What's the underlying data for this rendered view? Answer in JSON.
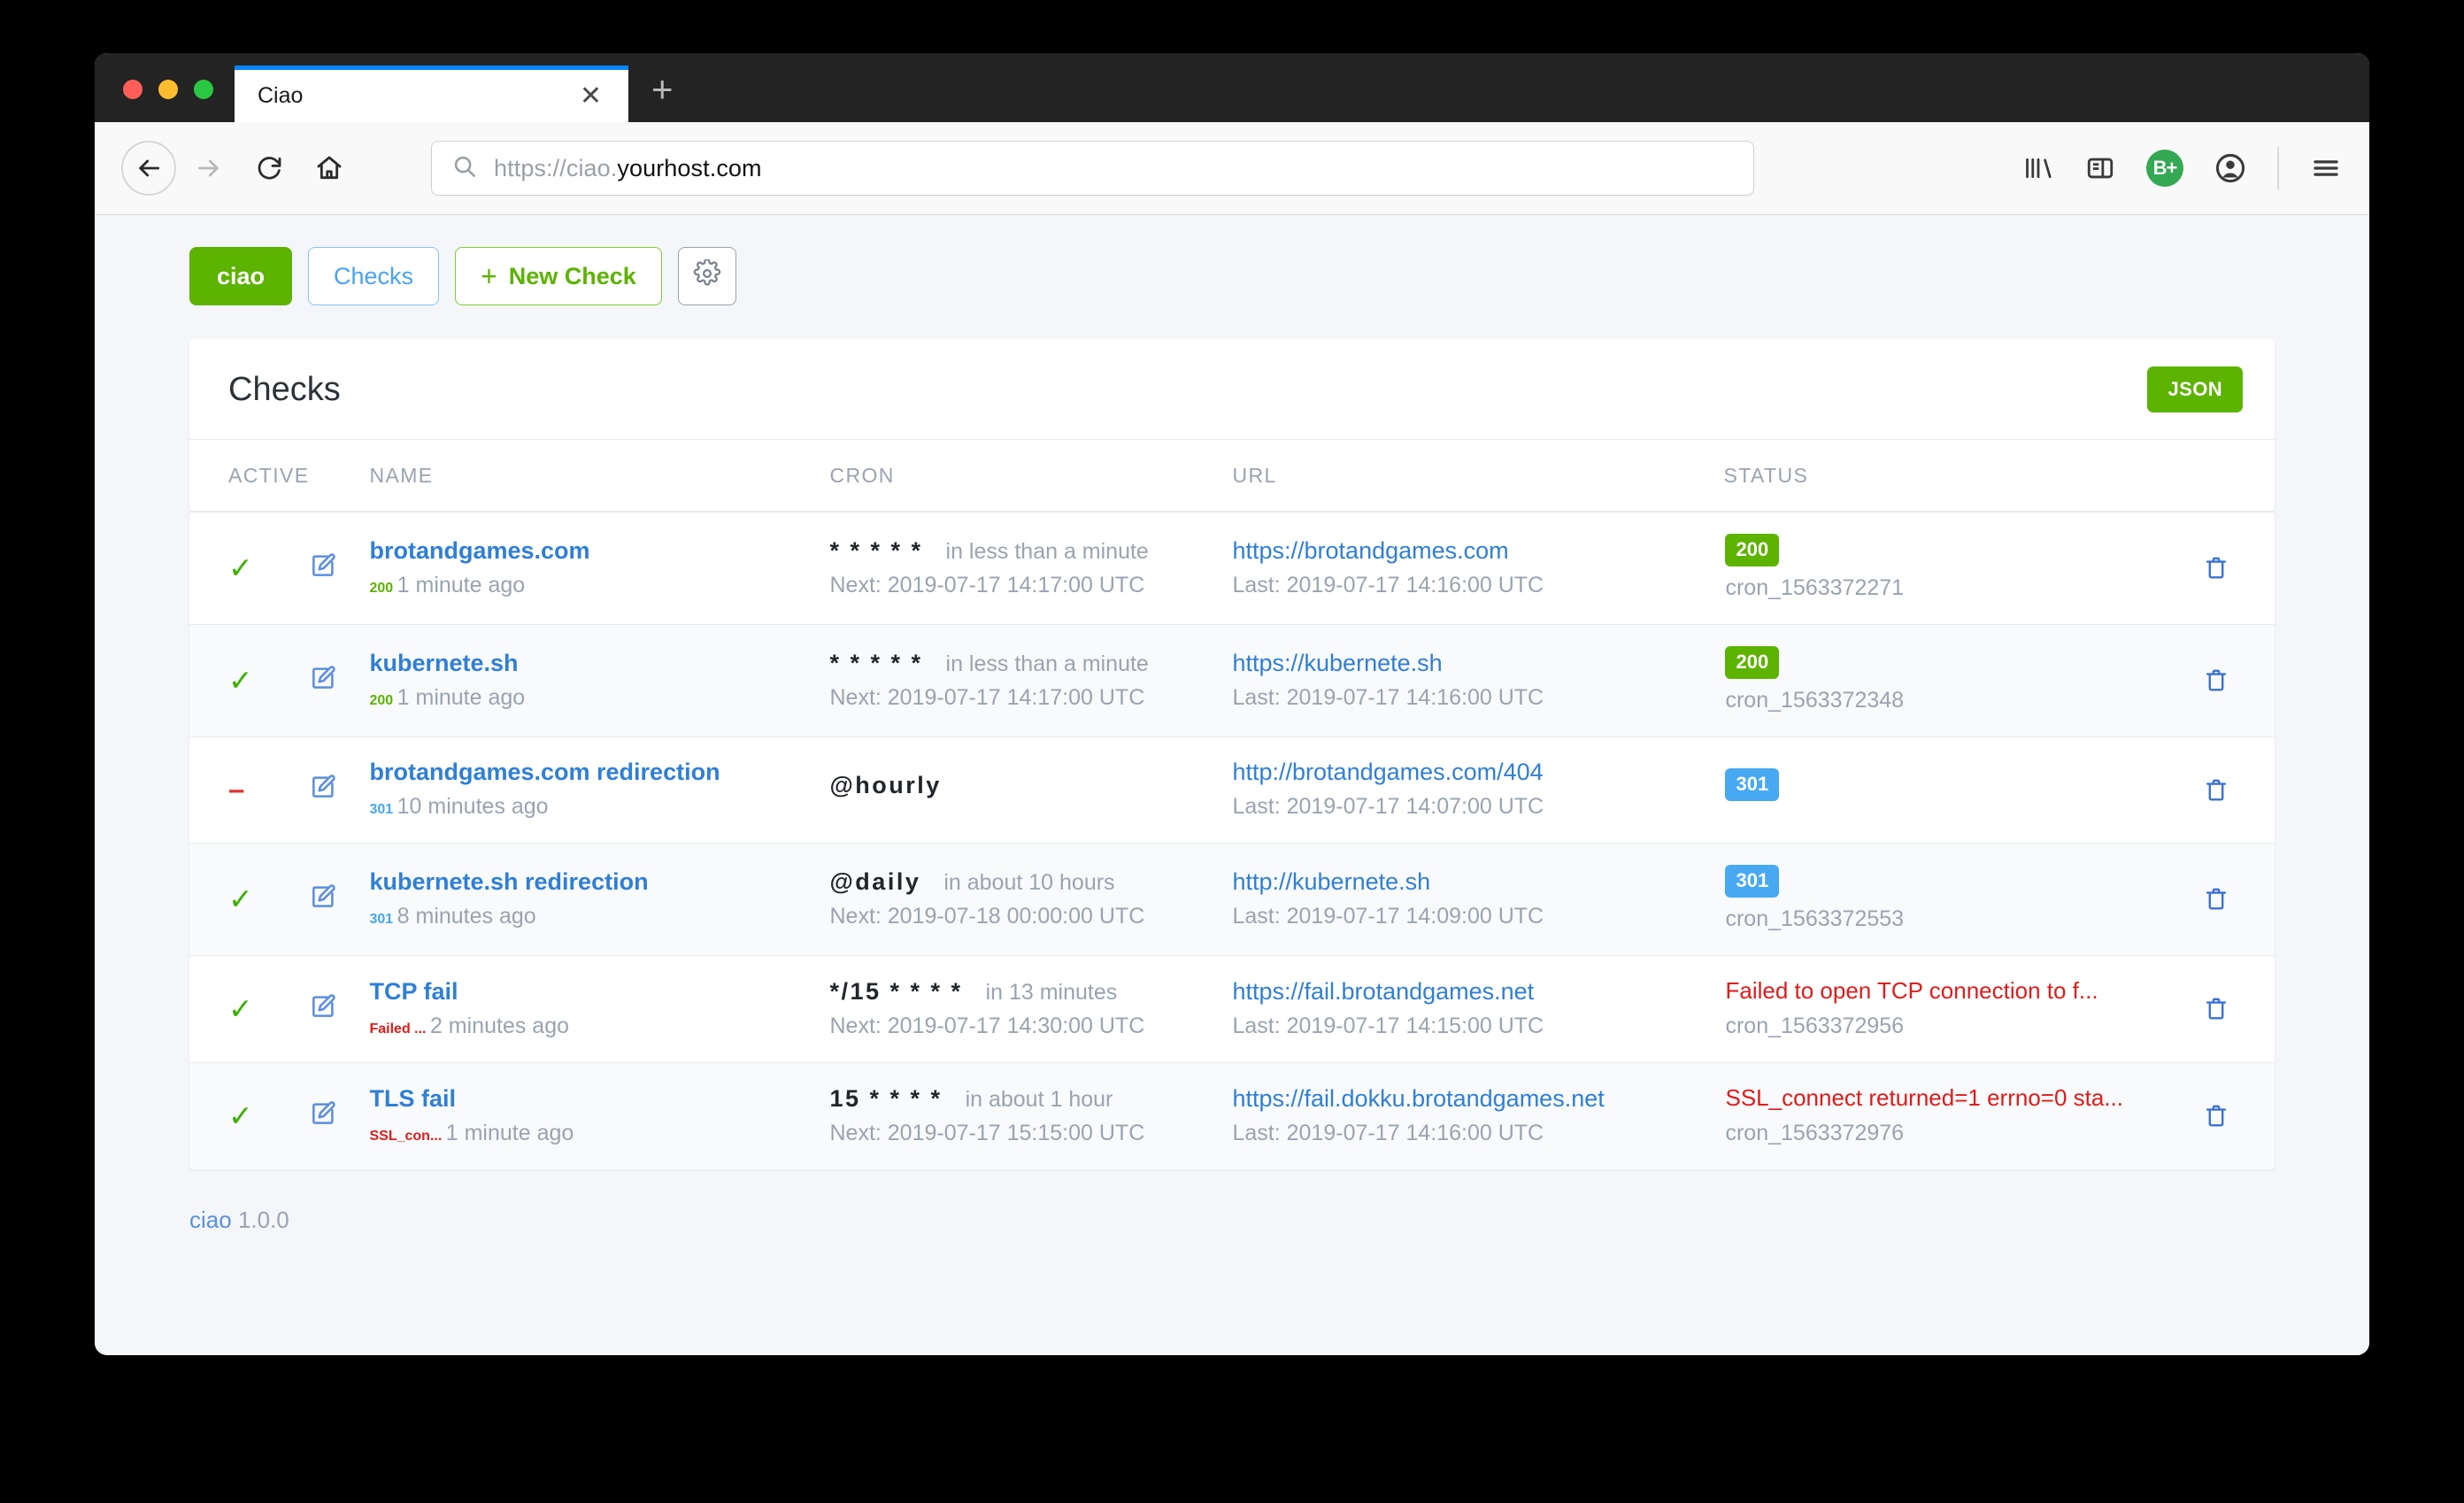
{
  "browser": {
    "tab_title": "Ciao",
    "tab_close_glyph": "✕",
    "new_tab_glyph": "+",
    "url_scheme": "https://ciao.",
    "url_host": "yourhost.com",
    "icons": {
      "back": "back-arrow-icon",
      "forward": "forward-arrow-icon",
      "reload": "reload-icon",
      "home": "home-icon",
      "search": "search-icon",
      "library": "library-icon",
      "sidebar": "sidebar-icon",
      "extension": "bitwarden-extension-icon",
      "extension_label": "B+",
      "account": "account-icon",
      "menu": "hamburger-menu-icon"
    }
  },
  "app": {
    "brand": "ciao",
    "nav": {
      "checks_label": "Checks",
      "new_check_label": "New Check",
      "new_check_plus": "+",
      "settings_icon": "gear-icon"
    },
    "card": {
      "title": "Checks",
      "json_label": "JSON"
    },
    "table": {
      "columns": [
        "ACTIVE",
        "NAME",
        "CRON",
        "URL",
        "STATUS"
      ],
      "rows": [
        {
          "active": true,
          "active_glyph": "✓",
          "name": "brotandgames.com",
          "code": "200",
          "code_kind": "ok",
          "code_age": "1 minute ago",
          "cron_expr": "* * * * *",
          "cron_relative": "in less than a minute",
          "cron_next": "Next: 2019-07-17 14:17:00 UTC",
          "url": "https://brotandgames.com",
          "url_last": "Last: 2019-07-17 14:16:00 UTC",
          "status_pill": "200",
          "status_pill_kind": "green",
          "status_error": "",
          "cron_id": "cron_1563372271"
        },
        {
          "active": true,
          "active_glyph": "✓",
          "name": "kubernete.sh",
          "code": "200",
          "code_kind": "ok",
          "code_age": "1 minute ago",
          "cron_expr": "* * * * *",
          "cron_relative": "in less than a minute",
          "cron_next": "Next: 2019-07-17 14:17:00 UTC",
          "url": "https://kubernete.sh",
          "url_last": "Last: 2019-07-17 14:16:00 UTC",
          "status_pill": "200",
          "status_pill_kind": "green",
          "status_error": "",
          "cron_id": "cron_1563372348"
        },
        {
          "active": false,
          "active_glyph": "–",
          "name": "brotandgames.com redirection",
          "code": "301",
          "code_kind": "redirect",
          "code_age": "10 minutes ago",
          "cron_expr": "@hourly",
          "cron_relative": "",
          "cron_next": "",
          "url": "http://brotandgames.com/404",
          "url_last": "Last: 2019-07-17 14:07:00 UTC",
          "status_pill": "301",
          "status_pill_kind": "blue",
          "status_error": "",
          "cron_id": ""
        },
        {
          "active": true,
          "active_glyph": "✓",
          "name": "kubernete.sh redirection",
          "code": "301",
          "code_kind": "redirect",
          "code_age": "8 minutes ago",
          "cron_expr": "@daily",
          "cron_relative": "in about 10 hours",
          "cron_next": "Next: 2019-07-18 00:00:00 UTC",
          "url": "http://kubernete.sh",
          "url_last": "Last: 2019-07-17 14:09:00 UTC",
          "status_pill": "301",
          "status_pill_kind": "blue",
          "status_error": "",
          "cron_id": "cron_1563372553"
        },
        {
          "active": true,
          "active_glyph": "✓",
          "name": "TCP fail",
          "code": "Failed ...",
          "code_kind": "error",
          "code_age": "2 minutes ago",
          "cron_expr": "*/15 * * * *",
          "cron_relative": "in 13 minutes",
          "cron_next": "Next: 2019-07-17 14:30:00 UTC",
          "url": "https://fail.brotandgames.net",
          "url_last": "Last: 2019-07-17 14:15:00 UTC",
          "status_pill": "",
          "status_pill_kind": "",
          "status_error": "Failed to open TCP connection to f...",
          "cron_id": "cron_1563372956"
        },
        {
          "active": true,
          "active_glyph": "✓",
          "name": "TLS fail",
          "code": "SSL_con...",
          "code_kind": "error",
          "code_age": "1 minute ago",
          "cron_expr": "15 * * * *",
          "cron_relative": "in about 1 hour",
          "cron_next": "Next: 2019-07-17 15:15:00 UTC",
          "url": "https://fail.dokku.brotandgames.net",
          "url_last": "Last: 2019-07-17 14:16:00 UTC",
          "status_pill": "",
          "status_pill_kind": "",
          "status_error": "SSL_connect returned=1 errno=0 sta...",
          "cron_id": "cron_1563372976"
        }
      ]
    },
    "footer": {
      "link": "ciao",
      "version": "1.0.0"
    }
  }
}
